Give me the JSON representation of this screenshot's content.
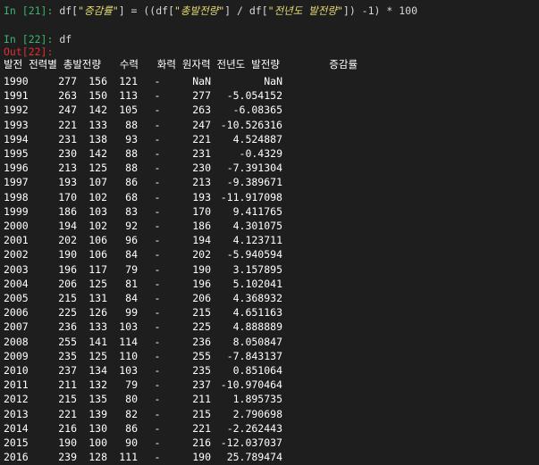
{
  "cell21": {
    "prompt": "In [21]:",
    "code_1": " df[",
    "str_1": "\"증감률\"",
    "code_2": "] = ((df[",
    "str_2": "\"총발전량\"",
    "code_3": "] / df[",
    "str_3": "\"전년도 발전량\"",
    "code_4": "]) -1) * ",
    "num_1": "100"
  },
  "cell22": {
    "prompt": "In [22]:",
    "code": " df"
  },
  "out22": {
    "prompt": "Out[22]:"
  },
  "table": {
    "header": "발전 전력별 총발전량   수력   화력 원자력 전년도 발전량        증감률",
    "rows": [
      {
        "year": "1990",
        "a": "277",
        "b": "156",
        "c": "121",
        "d": "-",
        "e": "NaN",
        "f": "NaN"
      },
      {
        "year": "1991",
        "a": "263",
        "b": "150",
        "c": "113",
        "d": "-",
        "e": "277",
        "f": "-5.054152"
      },
      {
        "year": "1992",
        "a": "247",
        "b": "142",
        "c": "105",
        "d": "-",
        "e": "263",
        "f": "-6.08365"
      },
      {
        "year": "1993",
        "a": "221",
        "b": "133",
        "c": "88",
        "d": "-",
        "e": "247",
        "f": "-10.526316"
      },
      {
        "year": "1994",
        "a": "231",
        "b": "138",
        "c": "93",
        "d": "-",
        "e": "221",
        "f": "4.524887"
      },
      {
        "year": "1995",
        "a": "230",
        "b": "142",
        "c": "88",
        "d": "-",
        "e": "231",
        "f": "-0.4329"
      },
      {
        "year": "1996",
        "a": "213",
        "b": "125",
        "c": "88",
        "d": "-",
        "e": "230",
        "f": "-7.391304"
      },
      {
        "year": "1997",
        "a": "193",
        "b": "107",
        "c": "86",
        "d": "-",
        "e": "213",
        "f": "-9.389671"
      },
      {
        "year": "1998",
        "a": "170",
        "b": "102",
        "c": "68",
        "d": "-",
        "e": "193",
        "f": "-11.917098"
      },
      {
        "year": "1999",
        "a": "186",
        "b": "103",
        "c": "83",
        "d": "-",
        "e": "170",
        "f": "9.411765"
      },
      {
        "year": "2000",
        "a": "194",
        "b": "102",
        "c": "92",
        "d": "-",
        "e": "186",
        "f": "4.301075"
      },
      {
        "year": "2001",
        "a": "202",
        "b": "106",
        "c": "96",
        "d": "-",
        "e": "194",
        "f": "4.123711"
      },
      {
        "year": "2002",
        "a": "190",
        "b": "106",
        "c": "84",
        "d": "-",
        "e": "202",
        "f": "-5.940594"
      },
      {
        "year": "2003",
        "a": "196",
        "b": "117",
        "c": "79",
        "d": "-",
        "e": "190",
        "f": "3.157895"
      },
      {
        "year": "2004",
        "a": "206",
        "b": "125",
        "c": "81",
        "d": "-",
        "e": "196",
        "f": "5.102041"
      },
      {
        "year": "2005",
        "a": "215",
        "b": "131",
        "c": "84",
        "d": "-",
        "e": "206",
        "f": "4.368932"
      },
      {
        "year": "2006",
        "a": "225",
        "b": "126",
        "c": "99",
        "d": "-",
        "e": "215",
        "f": "4.651163"
      },
      {
        "year": "2007",
        "a": "236",
        "b": "133",
        "c": "103",
        "d": "-",
        "e": "225",
        "f": "4.888889"
      },
      {
        "year": "2008",
        "a": "255",
        "b": "141",
        "c": "114",
        "d": "-",
        "e": "236",
        "f": "8.050847"
      },
      {
        "year": "2009",
        "a": "235",
        "b": "125",
        "c": "110",
        "d": "-",
        "e": "255",
        "f": "-7.843137"
      },
      {
        "year": "2010",
        "a": "237",
        "b": "134",
        "c": "103",
        "d": "-",
        "e": "235",
        "f": "0.851064"
      },
      {
        "year": "2011",
        "a": "211",
        "b": "132",
        "c": "79",
        "d": "-",
        "e": "237",
        "f": "-10.970464"
      },
      {
        "year": "2012",
        "a": "215",
        "b": "135",
        "c": "80",
        "d": "-",
        "e": "211",
        "f": "1.895735"
      },
      {
        "year": "2013",
        "a": "221",
        "b": "139",
        "c": "82",
        "d": "-",
        "e": "215",
        "f": "2.790698"
      },
      {
        "year": "2014",
        "a": "216",
        "b": "130",
        "c": "86",
        "d": "-",
        "e": "221",
        "f": "-2.262443"
      },
      {
        "year": "2015",
        "a": "190",
        "b": "100",
        "c": "90",
        "d": "-",
        "e": "216",
        "f": "-12.037037"
      },
      {
        "year": "2016",
        "a": "239",
        "b": "128",
        "c": "111",
        "d": "-",
        "e": "190",
        "f": "25.789474"
      }
    ]
  }
}
